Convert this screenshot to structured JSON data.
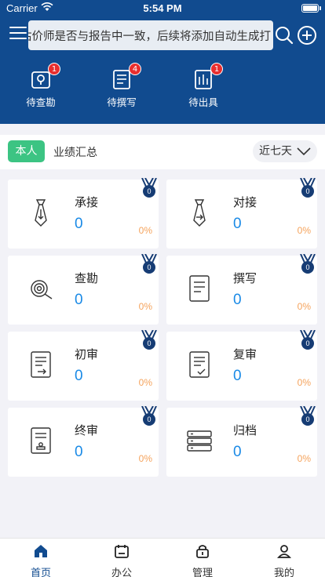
{
  "status_bar": {
    "carrier": "Carrier",
    "time": "5:54 PM"
  },
  "header": {
    "marquee_text": "估价师是否与报告中一致，后续将添加自动生成打"
  },
  "quick_actions": [
    {
      "label": "待查勘",
      "badge": "1",
      "icon": "survey-pin-icon"
    },
    {
      "label": "待撰写",
      "badge": "4",
      "icon": "write-doc-icon"
    },
    {
      "label": "待出具",
      "badge": "1",
      "icon": "issue-report-icon"
    }
  ],
  "filter": {
    "self_label": "本人",
    "summary_label": "业绩汇总",
    "range_value": "近七天"
  },
  "cards": [
    {
      "title": "承接",
      "count": "0",
      "percent": "0%",
      "medal": "0",
      "icon": "tie-in-icon"
    },
    {
      "title": "对接",
      "count": "0",
      "percent": "0%",
      "medal": "0",
      "icon": "tie-out-icon"
    },
    {
      "title": "查勘",
      "count": "0",
      "percent": "0%",
      "medal": "0",
      "icon": "target-icon"
    },
    {
      "title": "撰写",
      "count": "0",
      "percent": "0%",
      "medal": "0",
      "icon": "document-icon"
    },
    {
      "title": "初审",
      "count": "0",
      "percent": "0%",
      "medal": "0",
      "icon": "document-arrow-icon"
    },
    {
      "title": "复审",
      "count": "0",
      "percent": "0%",
      "medal": "0",
      "icon": "document-check-icon"
    },
    {
      "title": "终审",
      "count": "0",
      "percent": "0%",
      "medal": "0",
      "icon": "document-stamp-icon"
    },
    {
      "title": "归档",
      "count": "0",
      "percent": "0%",
      "medal": "0",
      "icon": "archive-icon"
    }
  ],
  "tabbar": [
    {
      "label": "首页",
      "icon": "home-icon",
      "active": true
    },
    {
      "label": "办公",
      "icon": "calendar-icon",
      "active": false
    },
    {
      "label": "管理",
      "icon": "lock-bag-icon",
      "active": false
    },
    {
      "label": "我的",
      "icon": "user-icon",
      "active": false
    }
  ],
  "colors": {
    "header_bg": "#114b8f",
    "self_button": "#3cc483",
    "count_blue": "#1a8ae6",
    "percent_orange": "#f5a35c",
    "badge_red": "#e82e2e"
  }
}
